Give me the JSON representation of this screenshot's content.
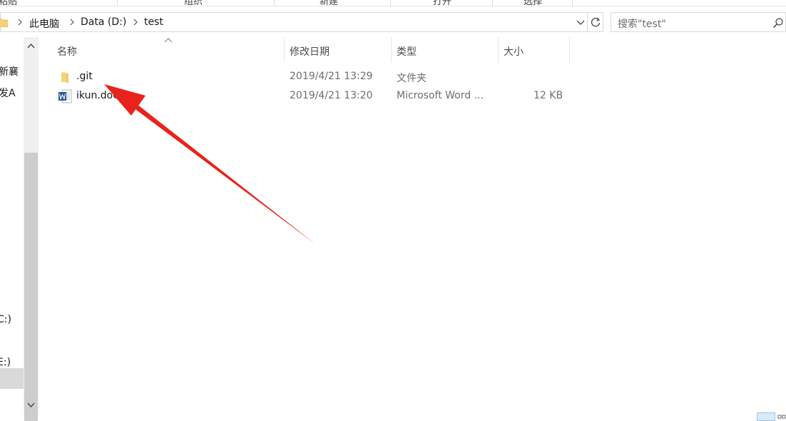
{
  "ribbon": {
    "labels": [
      "粘贴",
      "组织",
      "新建",
      "打开",
      "选择"
    ]
  },
  "address": {
    "crumbs": [
      "此电脑",
      "Data (D:)",
      "test"
    ]
  },
  "search": {
    "placeholder": "搜索\"test\""
  },
  "nav": {
    "items": [
      "新襄",
      "发A",
      "C:)",
      "E:)"
    ]
  },
  "columns": {
    "name": "名称",
    "date": "修改日期",
    "type": "类型",
    "size": "大小"
  },
  "files": [
    {
      "name": ".git",
      "date": "2019/4/21 13:29",
      "type": "文件夹",
      "size": "",
      "icon": "folder-icon"
    },
    {
      "name": "ikun.docx",
      "date": "2019/4/21 13:20",
      "type": "Microsoft Word ...",
      "size": "12 KB",
      "icon": "word-doc-icon"
    }
  ],
  "colors": {
    "annotation_arrow": "#e8231b",
    "folder": "#f5d27a",
    "word_blue": "#2b5797",
    "selection": "#d9d9d9"
  }
}
